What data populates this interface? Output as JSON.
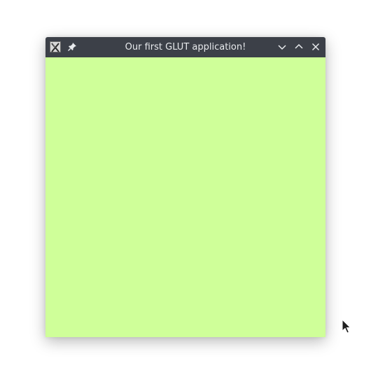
{
  "window": {
    "title": "Our first GLUT application!",
    "client_color": "#cfff99",
    "titlebar_color": "#3c4048"
  },
  "icons": {
    "app": "x-window-app-icon",
    "pin": "pin-icon",
    "minimize": "chevron-down-icon",
    "maximize": "chevron-up-icon",
    "close": "close-icon",
    "cursor": "mouse-pointer-icon"
  }
}
